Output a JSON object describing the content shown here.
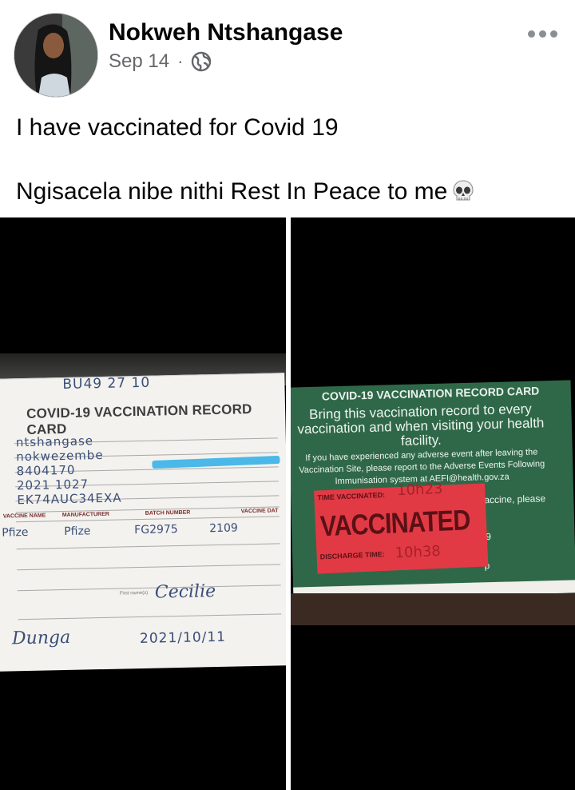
{
  "post": {
    "author": "Nokweh Ntshangase",
    "date": "Sep 14",
    "separator": "·",
    "privacy_icon": "globe-icon",
    "more_icon": "more-horizontal-icon",
    "text_line_1": "I have vaccinated for Covid 19",
    "text_line_2": "Ngisacela nibe nithi Rest In Peace to me",
    "emoji": "skull-icon"
  },
  "photo_left": {
    "card_title": "COVID-19 VACCINATION RECORD CARD",
    "handwritten_top": "BU49 27 10",
    "handwritten_rows": [
      "ntshangase",
      "nokwezembe",
      "8404170",
      "2021 1027",
      "EK74AUC34EXA"
    ],
    "columns": [
      "VACCINE NAME",
      "MANUFACTURER",
      "BATCH NUMBER",
      "VACCINE DAT"
    ],
    "row_values": [
      "Pfize",
      "Pfize",
      "FG2975",
      "2109"
    ],
    "label_first_name": "First name(s)",
    "signature_1": "Cecilie",
    "signature_2": "Dunga",
    "date_written": "2021/10/11"
  },
  "photo_right": {
    "card_title": "COVID-19 VACCINATION RECORD CARD",
    "bring_text": "Bring this vaccination record to every vaccination and when visiting your health facility.",
    "adverse_text": "If you have experienced any adverse event after leaving the Vaccination Site, please report to the Adverse Events Following Immunisation system at AEFI@health.gov.za",
    "stamp_label_top": "TIME VACCINATED:",
    "stamp_time_top": "10h23",
    "stamp_word": "VACCINATED",
    "stamp_label_bottom": "DISCHARGE TIME:",
    "stamp_time_bottom": "10h38",
    "side_text_1": "vaccine, please",
    "side_text_2": "a",
    "side_text_3": "99",
    "side_text_4": "p"
  }
}
